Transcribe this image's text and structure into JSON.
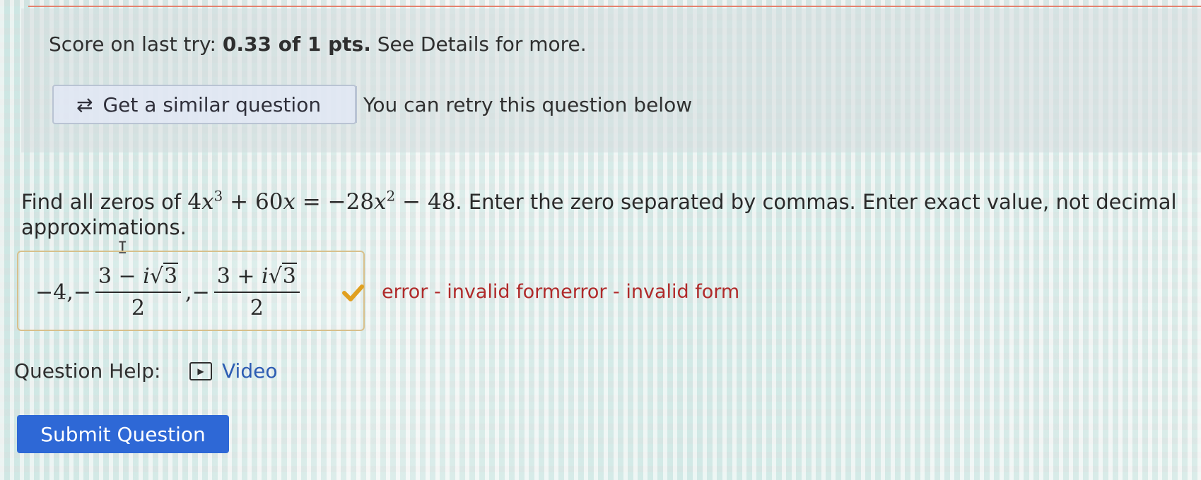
{
  "retry_panel": {
    "score_prefix": "Score on last try:",
    "score_value": "0.33 of 1 pts.",
    "score_suffix": "See Details for more.",
    "similar_button_label": "Get a similar question",
    "retry_note": "You can retry this question below"
  },
  "question": {
    "intro": "Find all zeros of",
    "equation": {
      "lhs_coef1": "4",
      "lhs_var1": "x",
      "lhs_exp1": "3",
      "plus": "+",
      "lhs_coef2": "60",
      "lhs_var2": "x",
      "equals": "=",
      "rhs_coef1": "−28",
      "rhs_var1": "x",
      "rhs_exp1": "2",
      "minus": "−",
      "rhs_const": "48"
    },
    "instructions": ". Enter the zero separated by commas. Enter exact value, not decimal approximations."
  },
  "answer": {
    "first_term": "−4,−",
    "frac1_num_a": "3 − ",
    "frac1_i": "i",
    "frac1_sqrt_sign": "√",
    "frac1_radicand": "3",
    "frac1_den": "2",
    "separator": ",−",
    "frac2_num_a": "3 + ",
    "frac2_i": "i",
    "frac2_sqrt_sign": "√",
    "frac2_radicand": "3",
    "frac2_den": "2",
    "status_icon": "check-icon",
    "check_color": "#e0a020",
    "error_message": "error - invalid formerror - invalid form"
  },
  "help": {
    "label": "Question Help:",
    "video_label": "Video",
    "video_icon": "play-icon"
  },
  "submit": {
    "label": "Submit Question",
    "color": "#2e68d6"
  },
  "cursor": {
    "glyph": "I"
  }
}
